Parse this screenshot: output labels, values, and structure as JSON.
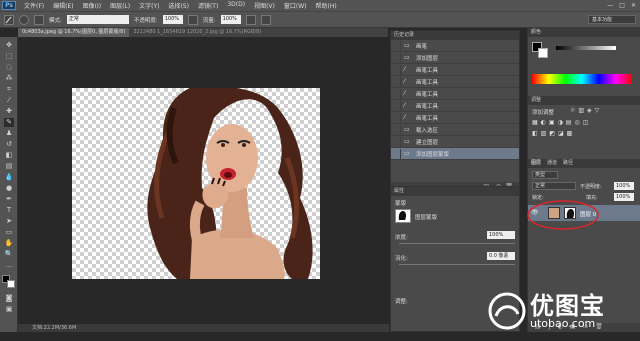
{
  "app": {
    "logo": "Ps"
  },
  "menu": [
    "文件(F)",
    "编辑(E)",
    "图像(I)",
    "图层(L)",
    "文字(Y)",
    "选择(S)",
    "滤镜(T)",
    "3D(D)",
    "视图(V)",
    "窗口(W)",
    "帮助(H)"
  ],
  "options": {
    "mode_label": "模式:",
    "mode_value": "正常",
    "opacity_label": "不透明度:",
    "opacity_value": "100%",
    "flow_label": "流量:",
    "flow_value": "100%",
    "workspace": "基本功能"
  },
  "tabs": [
    {
      "label": "0c4803a.jpeg @ 16.7%(图层0, 图层蒙版/8)",
      "active": true
    },
    {
      "label": "3212480 1_1654819 12020_2.jpg @ 16.7%(RGB/8)",
      "active": false
    }
  ],
  "status": {
    "text": "文档:22.2M/36.6M"
  },
  "history": {
    "title": "历史记录",
    "items": [
      {
        "label": "画笔",
        "icon": "document-icon"
      },
      {
        "label": "添加图层",
        "icon": "document-icon"
      },
      {
        "label": "画笔工具",
        "icon": "brush-icon"
      },
      {
        "label": "画笔工具",
        "icon": "brush-icon"
      },
      {
        "label": "画笔工具",
        "icon": "brush-icon"
      },
      {
        "label": "画笔工具",
        "icon": "brush-icon"
      },
      {
        "label": "画笔工具",
        "icon": "brush-icon"
      },
      {
        "label": "载入选区",
        "icon": "document-icon"
      },
      {
        "label": "建立图层",
        "icon": "document-icon"
      },
      {
        "label": "添加图层蒙版",
        "icon": "document-icon",
        "selected": true
      }
    ]
  },
  "properties": {
    "title": "属性",
    "subtitle": "蒙版",
    "mask_label": "图层蒙版",
    "density_label": "浓度:",
    "density_value": "100%",
    "feather_label": "羽化:",
    "feather_value": "0.0 像素",
    "refine_label": "调整:"
  },
  "color_panel": {
    "tab": "颜色"
  },
  "adjustments": {
    "tab": "调整",
    "hint": "添加调整"
  },
  "layers": {
    "tabs": [
      "图层",
      "通道",
      "路径"
    ],
    "kind": "类型",
    "blend": "正常",
    "opacity_label": "不透明度:",
    "opacity_value": "100%",
    "lock_label": "锁定:",
    "fill_label": "填充:",
    "fill_value": "100%",
    "layer_name": "图层 0"
  },
  "watermark": {
    "cn": "优图宝",
    "en": "utobao.com"
  },
  "colors": {
    "accent_sel": "#6c7a8c",
    "highlight_circle": "#d8262b",
    "bg": "#282828",
    "panel": "#4a4a4a"
  }
}
